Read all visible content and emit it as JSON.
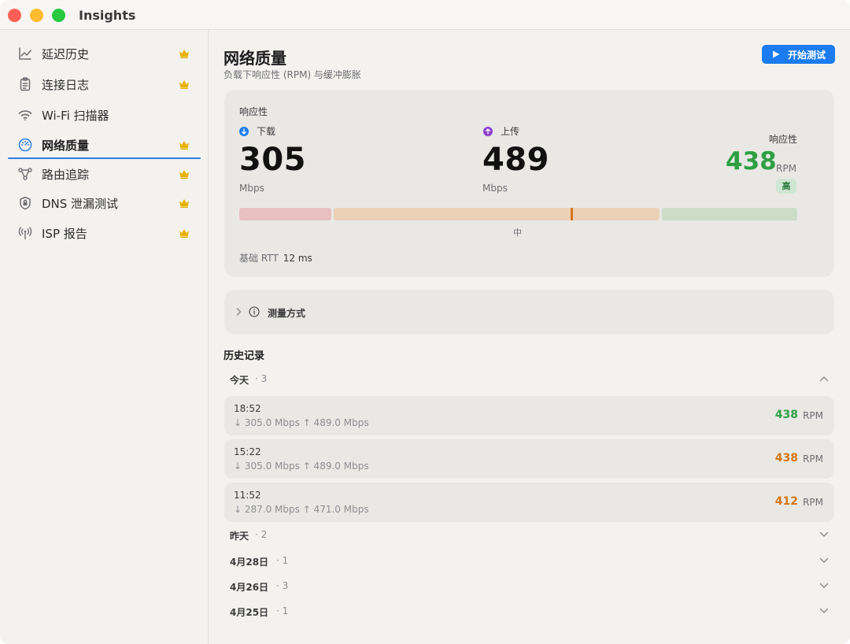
{
  "app": {
    "title": "Insights"
  },
  "colors": {
    "accent": "#1a7cf0",
    "good": "#2ea043",
    "warn": "#d47514",
    "crown": "#e8b100",
    "download_dot": "#1a7cf0",
    "upload_dot": "#8a3fd1"
  },
  "sidebar": {
    "items": [
      {
        "label": "延迟历史",
        "icon": "line-chart-icon",
        "premium": true,
        "active": false
      },
      {
        "label": "连接日志",
        "icon": "clipboard-icon",
        "premium": true,
        "active": false
      },
      {
        "label": "Wi-Fi 扫描器",
        "icon": "wifi-icon",
        "premium": false,
        "active": false
      },
      {
        "label": "网络质量",
        "icon": "gauge-icon",
        "premium": true,
        "active": true
      },
      {
        "label": "路由追踪",
        "icon": "route-icon",
        "premium": true,
        "active": false
      },
      {
        "label": "DNS 泄漏测试",
        "icon": "shield-lock-icon",
        "premium": true,
        "active": false
      },
      {
        "label": "ISP 报告",
        "icon": "antenna-icon",
        "premium": true,
        "active": false
      }
    ]
  },
  "main": {
    "title": "网络质量",
    "subtitle": "负载下响应性 (RPM) 与缓冲膨胀",
    "start_button": "开始测试",
    "card": {
      "section_label": "响应性",
      "download": {
        "label": "下载",
        "value": "305",
        "unit": "Mbps"
      },
      "upload": {
        "label": "上传",
        "value": "489",
        "unit": "Mbps"
      },
      "responsiveness": {
        "label": "响应性",
        "value": "438",
        "unit": "RPM",
        "badge": "高"
      },
      "scale": {
        "middle_label": "中",
        "marker_fraction": 0.73
      },
      "rtt": {
        "label": "基础 RTT",
        "value": "12 ms"
      }
    },
    "method": {
      "label": "测量方式"
    },
    "history": {
      "title": "历史记录",
      "groups": [
        {
          "label": "今天",
          "count": "· 3",
          "expanded": true
        },
        {
          "label": "昨天",
          "count": "· 2",
          "expanded": false
        },
        {
          "label": "4月28日",
          "count": "· 1",
          "expanded": false
        },
        {
          "label": "4月26日",
          "count": "· 3",
          "expanded": false
        },
        {
          "label": "4月25日",
          "count": "· 1",
          "expanded": false
        }
      ],
      "rows": [
        {
          "time": "18:52",
          "speeds": "↓ 305.0 Mbps  ↑ 489.0 Mbps",
          "rpm": "438",
          "unit": "RPM",
          "level": "good"
        },
        {
          "time": "15:22",
          "speeds": "↓ 305.0 Mbps  ↑ 489.0 Mbps",
          "rpm": "438",
          "unit": "RPM",
          "level": "warn"
        },
        {
          "time": "11:52",
          "speeds": "↓ 287.0 Mbps  ↑ 471.0 Mbps",
          "rpm": "412",
          "unit": "RPM",
          "level": "warn"
        }
      ]
    }
  }
}
